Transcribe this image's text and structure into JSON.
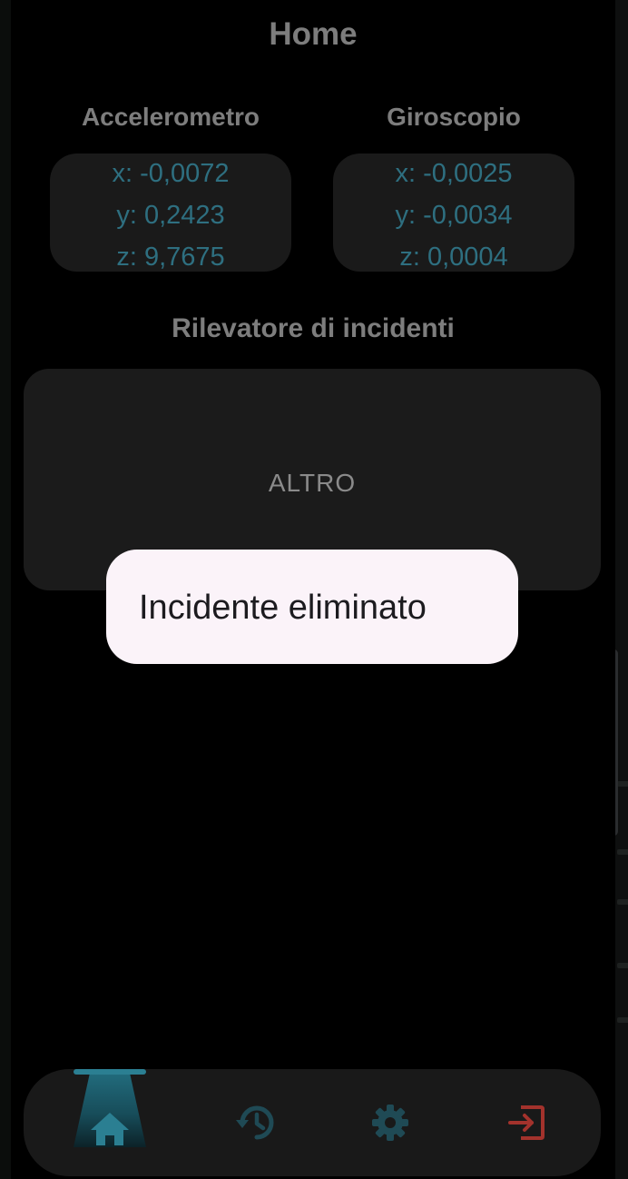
{
  "header": {
    "title": "Home"
  },
  "accelerometer": {
    "title": "Accelerometro",
    "x": "x: -0,0072",
    "y": "y: 0,2423",
    "z": "z: 9,7675"
  },
  "gyroscope": {
    "title": "Giroscopio",
    "x": "x: -0,0025",
    "y": "y: -0,0034",
    "z": "z: 0,0004"
  },
  "incident_detector": {
    "title": "Rilevatore di incidenti",
    "state": "ALTRO"
  },
  "toast": {
    "message": "Incidente eliminato"
  },
  "bottom_nav": {
    "items": [
      {
        "icon": "home-icon",
        "active": true
      },
      {
        "icon": "history-icon",
        "active": false
      },
      {
        "icon": "settings-icon",
        "active": false
      },
      {
        "icon": "logout-icon",
        "active": false
      }
    ]
  },
  "colors": {
    "background": "#000000",
    "card": "#1a1a1a",
    "heading": "#7d7d7d",
    "sensor_value": "#2e6f80",
    "accent": "#2b7f92",
    "inactive_icon": "#1f4a55",
    "logout": "#a3322c",
    "toast_background": "#fbf3f9"
  }
}
